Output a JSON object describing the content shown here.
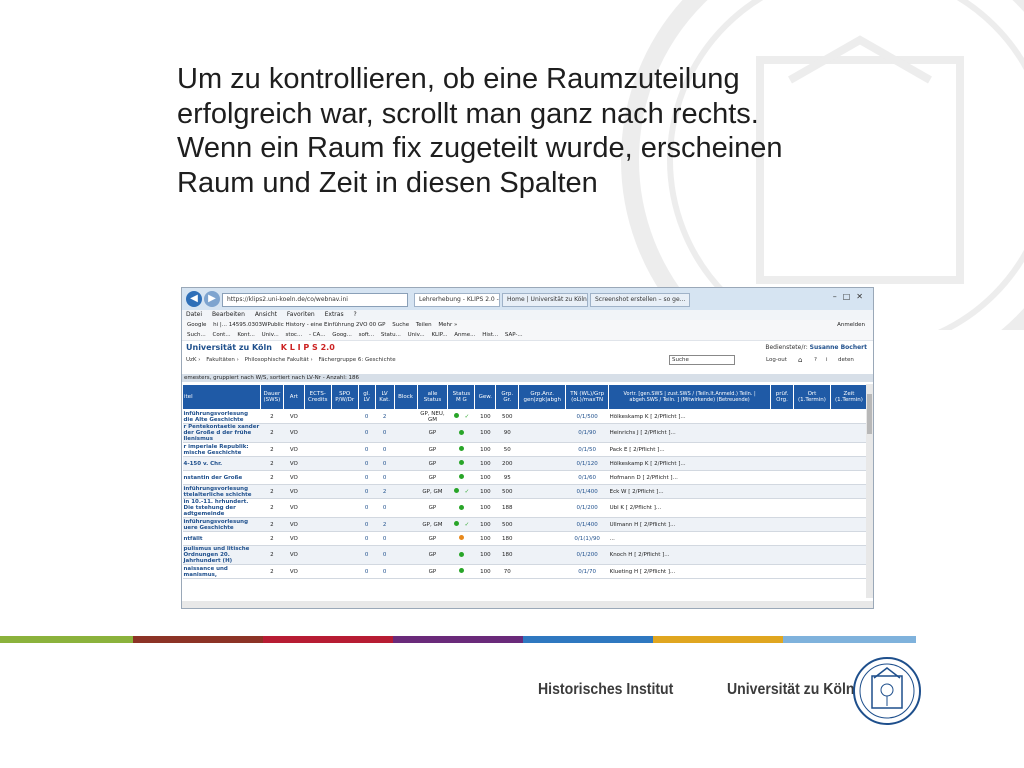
{
  "slide": {
    "headline": "Um zu kontrollieren, ob eine Raumzuteilung\nerfolgreich war, scrollt man ganz nach rechts.\nWenn ein Raum fix zugeteilt wurde, erscheinen\nRaum und Zeit in diesen Spalten",
    "footer_institute": "Historisches Institut",
    "footer_university": "Universität zu Köln"
  },
  "browser": {
    "url": "https://klips2.uni-koeln.de/co/webnav.ini",
    "tabs": [
      "Lehrerhebung - KLIPS 2.0 - ...",
      "Home | Universität zu Köln",
      "Screenshot erstellen – so ge..."
    ],
    "menu": [
      "Datei",
      "Bearbeiten",
      "Ansicht",
      "Favoriten",
      "Extras",
      "?"
    ],
    "toolbar1": [
      "Google",
      "hi |... 14595.0303WPublic History - eine Einführung 2VO 00 GP",
      "Suche",
      "Teilen",
      "Mehr »",
      "Anmelden"
    ],
    "toolbar2": [
      "Such...",
      "Cont...",
      "Kont...",
      "Univ...",
      "stoc...",
      "- CA...",
      "Goog...",
      "soft...",
      "Statu...",
      "Univ...",
      "KLIP...",
      "Anme...",
      "Hist...",
      "SAP-..."
    ]
  },
  "klips": {
    "logo": "Universität zu Köln",
    "klips": "K L I P S 2.0",
    "user_label": "Bedienstete/r:",
    "user_name": "Susanne Bochert",
    "breadcrumb": [
      "UzK",
      "Fakultäten",
      "Philosophische Fakultät",
      "Fächergruppe 6: Geschichte"
    ],
    "search_select": "Suche",
    "logout": "Log-out",
    "deutsch": "deten",
    "caption": "emesters, gruppiert nach W/S, sortiert nach LV-Nr - Anzahl: 186"
  },
  "table": {
    "headers": [
      "itel",
      "Dauer (SWS)",
      "Art",
      "ECTS-Credits",
      "SPO P/W/Dr",
      "gl. LV",
      "LV Kat.",
      "Block",
      "alle Status",
      "Status M G",
      "Gew.",
      "Grp. Gr.",
      "Grp.Anz. gen|zgk|abgh",
      "TN (WL)/Grp (oL)/maxTN",
      "Vortr. [gen.SWS | zust.SWS / (Teiln.lt.Anmeld.) Teiln. | abgeh.SWS / Teiln. ] (Mitwirkende) (Betreuende)",
      "prüf. Org.",
      "Ort (1.Termin)",
      "Zeit (1.Termin)"
    ],
    "rows": [
      {
        "title": "inführungsvorlesung die Alte Geschichte",
        "dauer": "2",
        "art": "VO",
        "gl": "0",
        "kat": "2",
        "status": "GP, NEU, GM",
        "dot": "green",
        "check": "✓",
        "gew": "100",
        "gr": "500",
        "tn": "0/1/500",
        "vortr": "Hölkeskamp K [ 2/Pflicht ]..."
      },
      {
        "title": "r Pentekontaetie xander der Große d der frühe llenismus",
        "dauer": "2",
        "art": "VO",
        "gl": "0",
        "kat": "0",
        "status": "GP",
        "dot": "green",
        "check": "",
        "gew": "100",
        "gr": "90",
        "tn": "0/1/90",
        "vortr": "Heinrichs J [ 2/Pflicht ]..."
      },
      {
        "title": "r imperiale Republik: mische Geschichte",
        "dauer": "2",
        "art": "VO",
        "gl": "0",
        "kat": "0",
        "status": "GP",
        "dot": "green",
        "check": "",
        "gew": "100",
        "gr": "50",
        "tn": "0/1/50",
        "vortr": "Pack E [ 2/Pflicht ]..."
      },
      {
        "title": "4-150 v. Chr.",
        "dauer": "2",
        "art": "VO",
        "gl": "0",
        "kat": "0",
        "status": "GP",
        "dot": "green",
        "check": "",
        "gew": "100",
        "gr": "200",
        "tn": "0/1/120",
        "vortr": "Hölkeskamp K [ 2/Pflicht ]..."
      },
      {
        "title": "nstantin der Große",
        "dauer": "2",
        "art": "VO",
        "gl": "0",
        "kat": "0",
        "status": "GP",
        "dot": "green",
        "check": "",
        "gew": "100",
        "gr": "95",
        "tn": "0/1/60",
        "vortr": "Hofmann D [ 2/Pflicht ]..."
      },
      {
        "title": "inführungsvorlesung ttelalterliche schichte",
        "dauer": "2",
        "art": "VO",
        "gl": "0",
        "kat": "2",
        "status": "GP, GM",
        "dot": "green",
        "check": "✓",
        "gew": "100",
        "gr": "500",
        "tn": "0/1/400",
        "vortr": "Eck W [ 2/Pflicht ]..."
      },
      {
        "title": "in 10.-11. hrhundert. Die tstehung der adtgemeinde",
        "dauer": "2",
        "art": "VO",
        "gl": "0",
        "kat": "0",
        "status": "GP",
        "dot": "green",
        "check": "",
        "gew": "100",
        "gr": "188",
        "tn": "0/1/200",
        "vortr": "Ubl K [ 2/Pflicht ]..."
      },
      {
        "title": "inführungsvorlesung uere Geschichte",
        "dauer": "2",
        "art": "VO",
        "gl": "0",
        "kat": "2",
        "status": "GP, GM",
        "dot": "green",
        "check": "✓",
        "gew": "100",
        "gr": "500",
        "tn": "0/1/400",
        "vortr": "Ullmann H [ 2/Pflicht ]..."
      },
      {
        "title": "ntfällt",
        "dauer": "2",
        "art": "VO",
        "gl": "0",
        "kat": "0",
        "status": "GP",
        "dot": "orange",
        "check": "",
        "gew": "100",
        "gr": "180",
        "tn": "0/1(1)/90",
        "vortr": "..."
      },
      {
        "title": "pulismus und litische Ordnungen 20. Jahrhundert (H)",
        "dauer": "2",
        "art": "VO",
        "gl": "0",
        "kat": "0",
        "status": "GP",
        "dot": "green",
        "check": "",
        "gew": "100",
        "gr": "180",
        "tn": "0/1/200",
        "vortr": "Knoch H [ 2/Pflicht ]..."
      },
      {
        "title": "naissance und manismus,",
        "dauer": "2",
        "art": "VO",
        "gl": "0",
        "kat": "0",
        "status": "GP",
        "dot": "green",
        "check": "",
        "gew": "100",
        "gr": "70",
        "tn": "0/1/70",
        "vortr": "Klueting H [ 2/Pflicht ]..."
      }
    ]
  },
  "colors": {
    "stripe": [
      "#8bb23c",
      "#8c3326",
      "#b71c33",
      "#6a2a7a",
      "#2f78c0",
      "#e0a620",
      "#7fb2dc"
    ],
    "table_header": "#1f5aa6"
  }
}
